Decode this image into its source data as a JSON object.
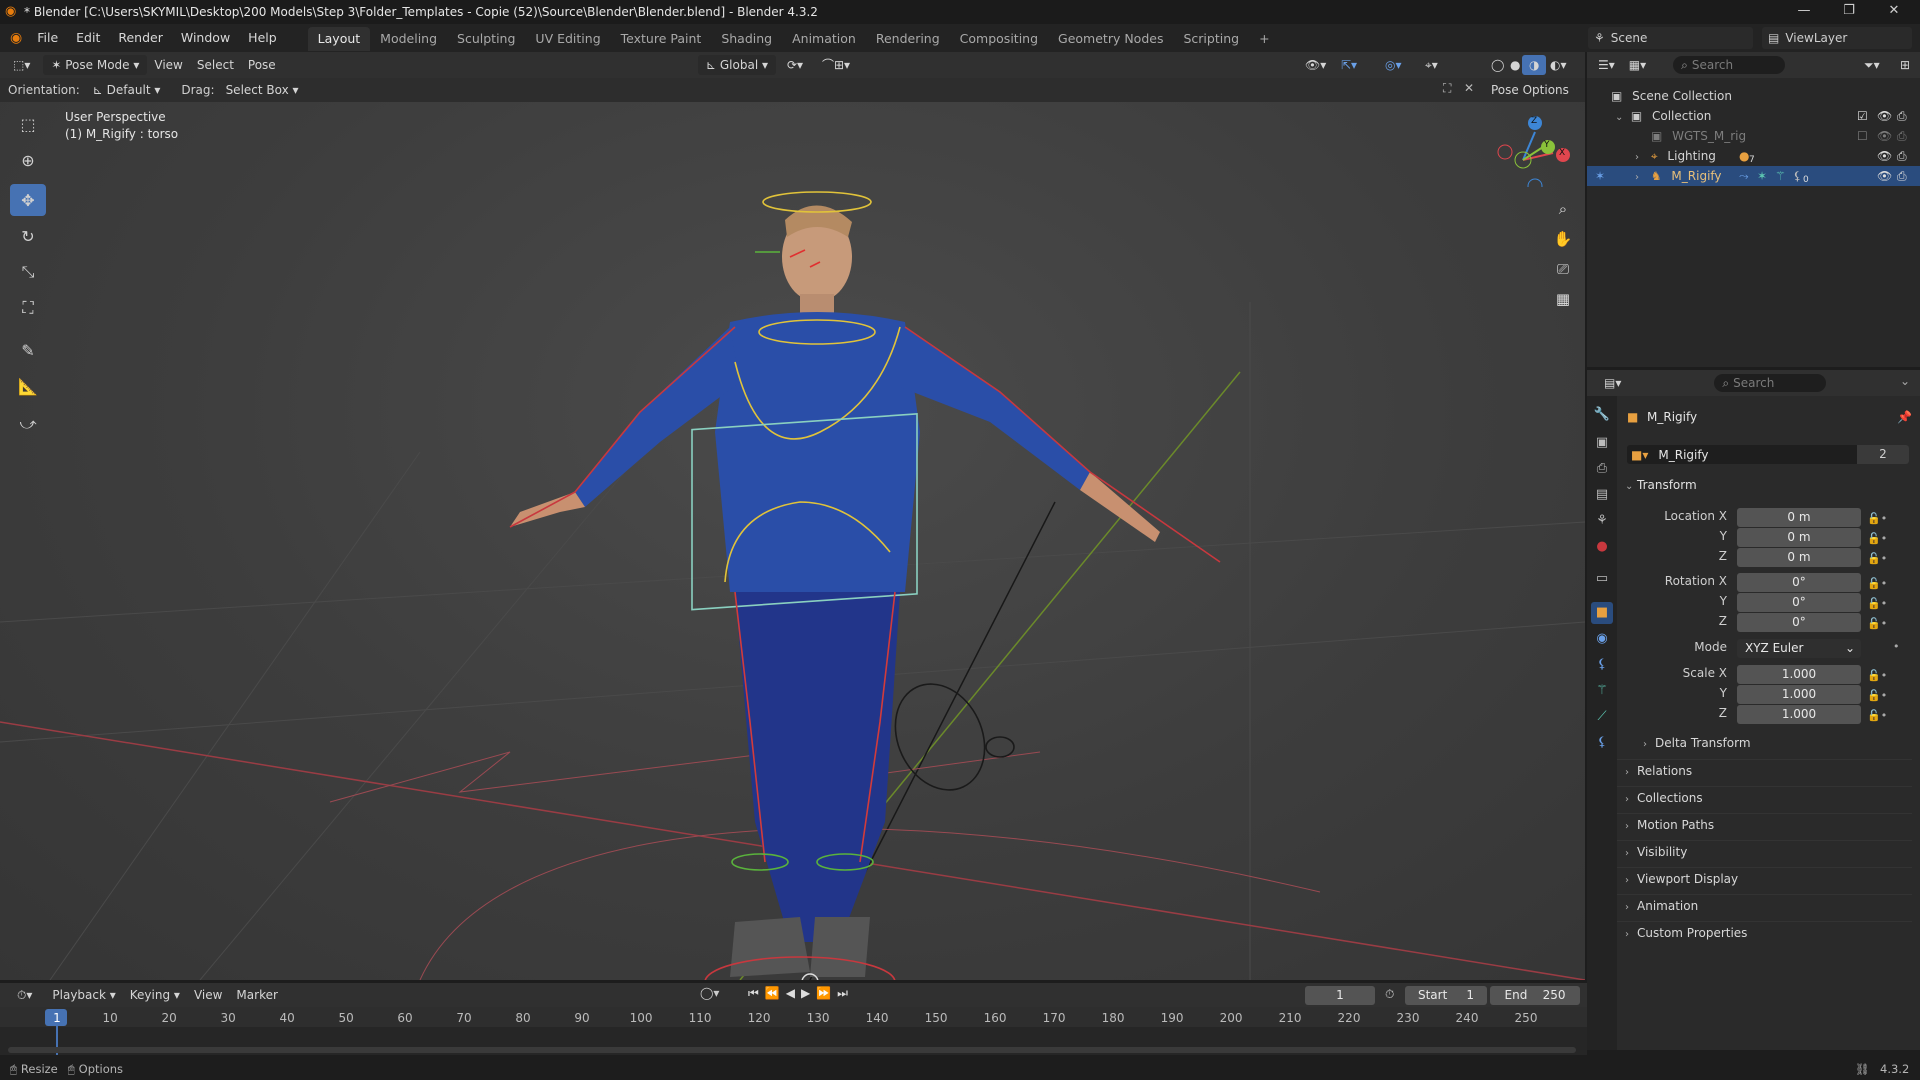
{
  "window": {
    "title": "* Blender [C:\\Users\\SKYMIL\\Desktop\\200 Models\\Step 3\\Folder_Templates - Copie (52)\\Source\\Blender\\Blender.blend] - Blender 4.3.2",
    "minimize": "—",
    "maximize": "❐",
    "close": "✕"
  },
  "menubar": {
    "menus": [
      "File",
      "Edit",
      "Render",
      "Window",
      "Help"
    ],
    "workspaces": [
      "Layout",
      "Modeling",
      "Sculpting",
      "UV Editing",
      "Texture Paint",
      "Shading",
      "Animation",
      "Rendering",
      "Compositing",
      "Geometry Nodes",
      "Scripting"
    ],
    "active_workspace": "Layout",
    "add_tab": "+",
    "scene": "Scene",
    "view_layer": "ViewLayer"
  },
  "viewport_header": {
    "mode": "Pose Mode",
    "menus": [
      "View",
      "Select",
      "Pose"
    ],
    "transform_orientation": "Global",
    "orientation_label": "Orientation:",
    "orientation_value": "Default",
    "drag_label": "Drag:",
    "drag_value": "Select Box",
    "pose_options": "Pose Options"
  },
  "viewport": {
    "perspective": "User Perspective",
    "object_info": "(1) M_Rigify : torso",
    "gizmo_axes": [
      "X",
      "Y",
      "Z"
    ]
  },
  "outliner": {
    "search_placeholder": "Search",
    "items": [
      {
        "label": "Scene Collection",
        "indent": 0
      },
      {
        "label": "Collection",
        "indent": 1
      },
      {
        "label": "WGTS_M_rig",
        "indent": 2
      },
      {
        "label": "Lighting",
        "indent": 2,
        "badge": "7"
      },
      {
        "label": "M_Rigify",
        "indent": 2,
        "selected": true,
        "badge": "0"
      }
    ]
  },
  "properties": {
    "search_placeholder": "Search",
    "object_name": "M_Rigify",
    "datablock_name": "M_Rigify",
    "users": "2",
    "transform_title": "Transform",
    "location": {
      "label": "Location X",
      "x": "0 m",
      "y": "0 m",
      "z": "0 m"
    },
    "rotation": {
      "label": "Rotation X",
      "x": "0°",
      "y": "0°",
      "z": "0°"
    },
    "mode_label": "Mode",
    "mode_value": "XYZ Euler",
    "scale": {
      "label": "Scale X",
      "x": "1.000",
      "y": "1.000",
      "z": "1.000"
    },
    "axis_y": "Y",
    "axis_z": "Z",
    "sections": [
      "Delta Transform",
      "Relations",
      "Collections",
      "Motion Paths",
      "Visibility",
      "Viewport Display",
      "Animation",
      "Custom Properties"
    ]
  },
  "timeline": {
    "menus": [
      "Playback",
      "Keying",
      "View",
      "Marker"
    ],
    "current_frame": "1",
    "start_label": "Start",
    "start": "1",
    "end_label": "End",
    "end": "250",
    "frame_numbers": [
      "1",
      "10",
      "20",
      "30",
      "40",
      "50",
      "60",
      "70",
      "80",
      "90",
      "100",
      "110",
      "120",
      "130",
      "140",
      "150",
      "160",
      "170",
      "180",
      "190",
      "200",
      "210",
      "220",
      "230",
      "240",
      "250"
    ]
  },
  "statusbar": {
    "resize": "Resize",
    "options": "Options",
    "version": "4.3.2"
  },
  "colors": {
    "accent": "#4672b3",
    "selection": "#2a4c7e",
    "x_axis": "#e0464e",
    "y_axis": "#8ac23a",
    "z_axis": "#3d86d6"
  }
}
